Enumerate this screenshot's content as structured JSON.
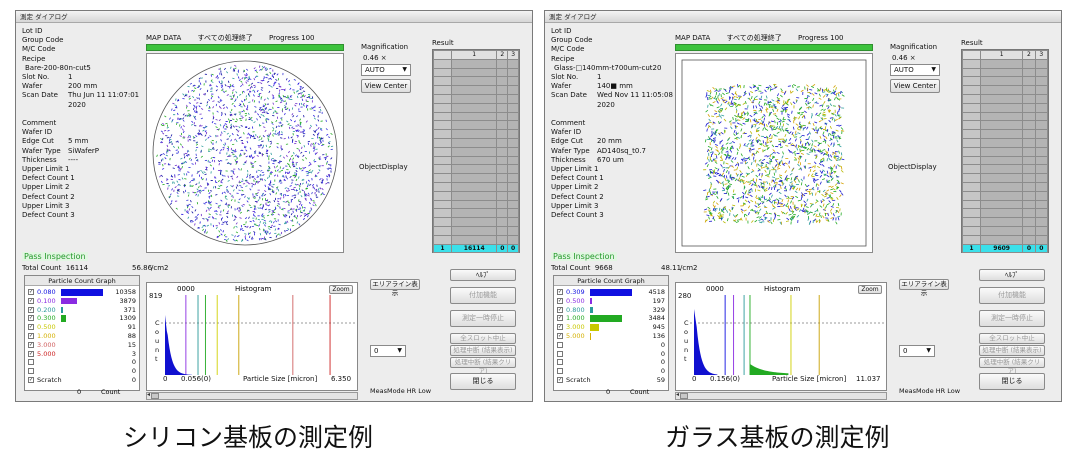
{
  "captions": [
    "シリコン基板の測定例",
    "ガラス基板の測定例"
  ],
  "panels": [
    {
      "title": "測定 ダイアログ",
      "info": {
        "lot_id": "Lot ID",
        "group_code": "Group Code",
        "mc_code": "M/C Code",
        "recipe_label": "Recipe",
        "recipe_value": "Bare-200-80n-cut5",
        "slot_no_label": "Slot No.",
        "slot_no_value": "1",
        "wafer_label": "Wafer",
        "wafer_value": "200 mm",
        "scan_date_label": "Scan Date",
        "scan_date_value": "Thu Jun 11 11:07:01 2020",
        "comment": "Comment",
        "wafer_id": "Wafer ID",
        "edge_cut_label": "Edge Cut",
        "edge_cut_value": "5 mm",
        "wafer_type_label": "Wafer Type",
        "wafer_type_value": "SiWaferP",
        "thickness_label": "Thickness",
        "thickness_value": "----",
        "upper_limit_1": "Upper Limit 1",
        "defect_count_1": "Defect Count 1",
        "upper_limit_2": "Upper Limit 2",
        "defect_count_2": "Defect Count 2",
        "upper_limit_3": "Upper Limit 3",
        "defect_count_3": "Defect Count 3"
      },
      "map_header": {
        "label": "MAP DATA",
        "status": "すべての処理終了",
        "progress": "Progress 100"
      },
      "map_shape": "circle",
      "magnification": {
        "label": "Magnification",
        "value": "0.46 ×",
        "mode": "AUTO",
        "view_center": "View Center"
      },
      "object_display": "ObjectDisplay",
      "result": {
        "label": "Result",
        "headers": [
          "",
          "1",
          "2",
          "3"
        ],
        "selected_row": [
          "1",
          "16114",
          "0",
          "0"
        ]
      },
      "pass_inspection": "Pass Inspection",
      "total": {
        "label": "Total Count",
        "count": "16114",
        "density": "56.86",
        "unit": "/cm2"
      },
      "pcg": {
        "title": "Particle Count Graph",
        "rows": [
          {
            "checked": true,
            "label": "0.080",
            "color": "#1010e0",
            "count": "10358",
            "frac": 1.0
          },
          {
            "checked": true,
            "label": "0.100",
            "color": "#8a2be2",
            "count": "3879",
            "frac": 0.37
          },
          {
            "checked": true,
            "label": "0.200",
            "color": "#2a9a9a",
            "count": "371",
            "frac": 0.036
          },
          {
            "checked": true,
            "label": "0.300",
            "color": "#22aa22",
            "count": "1309",
            "frac": 0.126
          },
          {
            "checked": true,
            "label": "0.500",
            "color": "#c8c800",
            "count": "91",
            "frac": 0.0
          },
          {
            "checked": true,
            "label": "1.000",
            "color": "#d4b000",
            "count": "88",
            "frac": 0.0
          },
          {
            "checked": true,
            "label": "3.000",
            "color": "#d06060",
            "count": "15",
            "frac": 0.0
          },
          {
            "checked": true,
            "label": "5.000",
            "color": "#cc2020",
            "count": "3",
            "frac": 0.0
          },
          {
            "checked": false,
            "label": "",
            "color": "#000000",
            "count": "0",
            "frac": 0.0
          },
          {
            "checked": false,
            "label": "",
            "color": "#000000",
            "count": "0",
            "frac": 0.0
          },
          {
            "checked": true,
            "label": "Scratch",
            "color": "#111111",
            "count": "0",
            "frac": 0.0
          }
        ],
        "axis_min": "0",
        "axis_label": "Count"
      },
      "histogram": {
        "ymax": "819",
        "title_num": "0000",
        "title": "Histogram",
        "zoom": "Zoom",
        "ylabel_chars": [
          "C",
          "o",
          "u",
          "n",
          "t"
        ],
        "x0": "0",
        "x1": "0.056(0)",
        "xlabel": "Particle Size [micron]",
        "xmax": "6.350",
        "lines": [
          {
            "x": 0.08,
            "color": "#8a2be2"
          },
          {
            "x": 0.2,
            "color": "#2a9a9a"
          },
          {
            "x": 0.3,
            "color": "#22aa22"
          },
          {
            "x": 0.5,
            "color": "#d0d000"
          },
          {
            "x": 1.0,
            "color": "#c8a000"
          },
          {
            "x": 3.0,
            "color": "#d06060"
          },
          {
            "x": 5.0,
            "color": "#cc2020"
          }
        ]
      },
      "area_button": "エリアライン表示",
      "drop2": "0",
      "measmode": "MeasMode HR Low",
      "buttons": {
        "help": "ﾍﾙﾌﾟ",
        "addon": "付加機能",
        "pause": "測定一時停止",
        "all_slot_stop": "全スロット中止",
        "mid_show": "処理中断 (結果表示)",
        "mid_clear": "処理中断 (結果クリア)",
        "close": "閉じる"
      }
    },
    {
      "title": "測定 ダイアログ",
      "info": {
        "lot_id": "Lot ID",
        "group_code": "Group Code",
        "mc_code": "M/C Code",
        "recipe_label": "Recipe",
        "recipe_value": "Glass-□140mm-t700um-cut20",
        "slot_no_label": "Slot No.",
        "slot_no_value": "1",
        "wafer_label": "Wafer",
        "wafer_value": "140■ mm",
        "scan_date_label": "Scan Date",
        "scan_date_value": "Wed Nov 11 11:05:08 2020",
        "comment": "Comment",
        "wafer_id": "Wafer ID",
        "edge_cut_label": "Edge Cut",
        "edge_cut_value": "20 mm",
        "wafer_type_label": "Wafer Type",
        "wafer_type_value": "AD140sq_t0.7",
        "thickness_label": "Thickness",
        "thickness_value": "670 um",
        "upper_limit_1": "Upper Limit 1",
        "defect_count_1": "Defect Count 1",
        "upper_limit_2": "Upper Limit 2",
        "defect_count_2": "Defect Count 2",
        "upper_limit_3": "Upper Limit 3",
        "defect_count_3": "Defect Count 3"
      },
      "map_header": {
        "label": "MAP DATA",
        "status": "すべての処理終了",
        "progress": "Progress 100"
      },
      "map_shape": "square",
      "magnification": {
        "label": "Magnification",
        "value": "0.46 ×",
        "mode": "AUTO",
        "view_center": "View Center"
      },
      "object_display": "ObjectDisplay",
      "result": {
        "label": "Result",
        "headers": [
          "",
          "1",
          "2",
          "3"
        ],
        "selected_row": [
          "1",
          "9609",
          "0",
          "0"
        ]
      },
      "pass_inspection": "Pass Inspection",
      "total": {
        "label": "Total Count",
        "count": "9668",
        "density": "48.11",
        "unit": "/cm2"
      },
      "pcg": {
        "title": "Particle Count Graph",
        "rows": [
          {
            "checked": true,
            "label": "0.309",
            "color": "#1010e0",
            "count": "4518",
            "frac": 1.0
          },
          {
            "checked": true,
            "label": "0.500",
            "color": "#8a2be2",
            "count": "197",
            "frac": 0.044
          },
          {
            "checked": true,
            "label": "0.800",
            "color": "#2a9a9a",
            "count": "329",
            "frac": 0.073
          },
          {
            "checked": true,
            "label": "1.000",
            "color": "#22aa22",
            "count": "3484",
            "frac": 0.77
          },
          {
            "checked": true,
            "label": "3.000",
            "color": "#c8c800",
            "count": "945",
            "frac": 0.21
          },
          {
            "checked": true,
            "label": "5.000",
            "color": "#d4b000",
            "count": "136",
            "frac": 0.03
          },
          {
            "checked": false,
            "label": "",
            "color": "#000000",
            "count": "0",
            "frac": 0.0
          },
          {
            "checked": false,
            "label": "",
            "color": "#000000",
            "count": "0",
            "frac": 0.0
          },
          {
            "checked": false,
            "label": "",
            "color": "#000000",
            "count": "0",
            "frac": 0.0
          },
          {
            "checked": false,
            "label": "",
            "color": "#000000",
            "count": "0",
            "frac": 0.0
          },
          {
            "checked": true,
            "label": "Scratch",
            "color": "#111111",
            "count": "59",
            "frac": 0.0
          }
        ],
        "axis_min": "0",
        "axis_label": "Count"
      },
      "histogram": {
        "ymax": "280",
        "title_num": "0000",
        "title": "Histogram",
        "zoom": "Zoom",
        "ylabel_chars": [
          "C",
          "o",
          "u",
          "n",
          "t"
        ],
        "x0": "0",
        "x1": "0.156(0)",
        "xlabel": "Particle Size [micron]",
        "xmax": "11.037",
        "lines": [
          {
            "x": 0.309,
            "color": "#1010e0"
          },
          {
            "x": 0.5,
            "color": "#8a2be2"
          },
          {
            "x": 0.8,
            "color": "#2a9a9a"
          },
          {
            "x": 1.0,
            "color": "#22aa22"
          },
          {
            "x": 3.0,
            "color": "#d0d000"
          },
          {
            "x": 5.0,
            "color": "#c8a000"
          }
        ]
      },
      "area_button": "エリアライン表示",
      "drop2": "0",
      "measmode": "MeasMode HR Low",
      "buttons": {
        "help": "ﾍﾙﾌﾟ",
        "addon": "付加機能",
        "pause": "測定一時停止",
        "all_slot_stop": "全スロット中止",
        "mid_show": "処理中断 (結果表示)",
        "mid_clear": "処理中断 (結果クリア)",
        "close": "閉じる"
      }
    }
  ]
}
